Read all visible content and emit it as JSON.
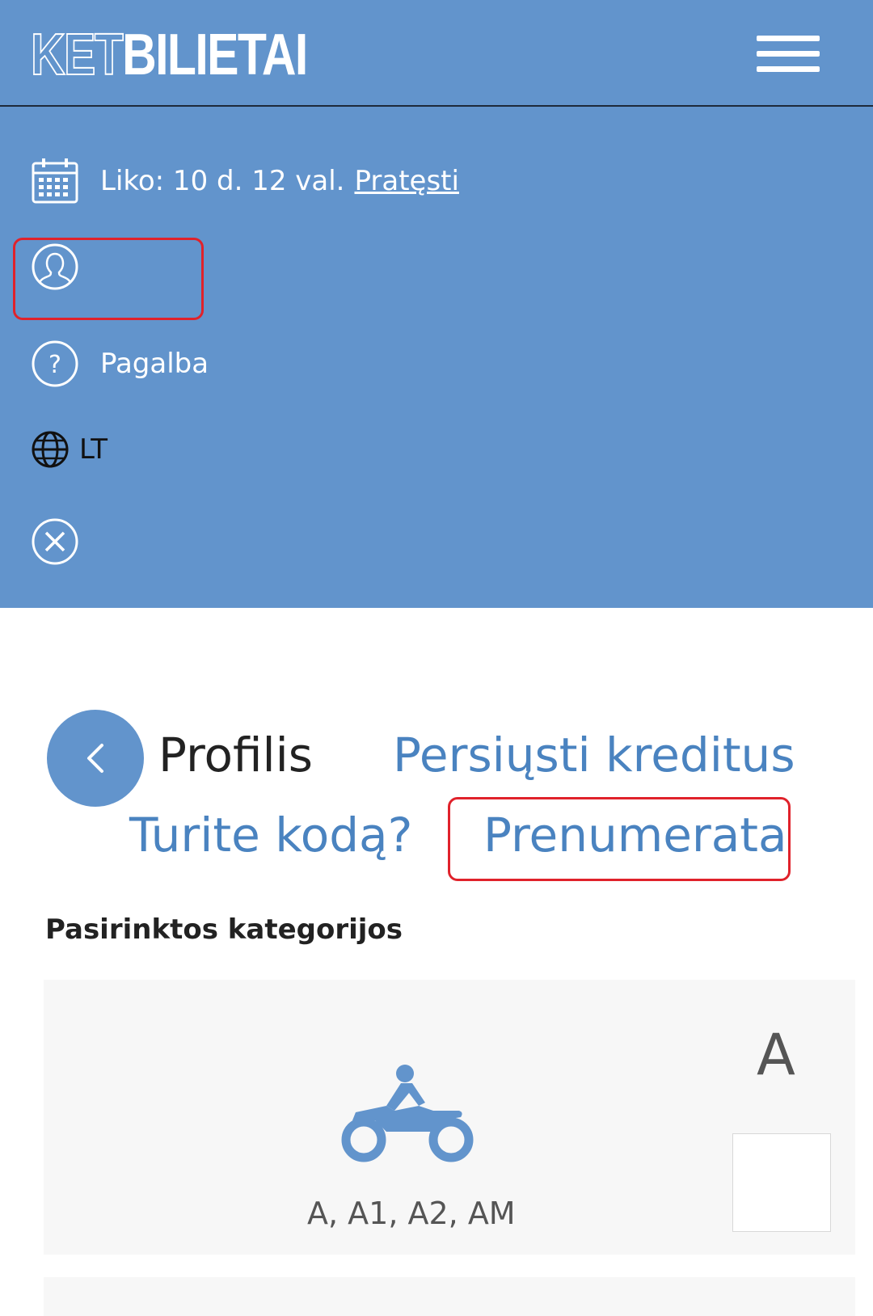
{
  "header": {
    "logo_part1": "KET",
    "logo_part2": "BILIETAI",
    "menu_icon": "hamburger-icon"
  },
  "menu": {
    "expiry_text": "Liko: 10 d. 12 val.",
    "extend_link": "Pratęsti",
    "help_label": "Pagalba",
    "language": "LT",
    "icons": [
      "calendar-icon",
      "user-icon",
      "help-icon",
      "globe-icon",
      "close-icon"
    ]
  },
  "tabs": {
    "profile": "Profilis",
    "transfer_credits": "Persiųsti kreditus",
    "have_code": "Turite kodą?",
    "subscription": "Prenumerata"
  },
  "categories": {
    "title": "Pasirinktos kategorijos",
    "items": [
      {
        "letter": "A",
        "subtitle": "A, A1, A2, AM",
        "icon": "motorcycle-icon",
        "checked": false
      }
    ]
  },
  "colors": {
    "brand_blue": "#6294cc",
    "link_blue": "#4a83c0",
    "highlight_red": "#e0222b",
    "card_bg": "#f7f7f7"
  }
}
